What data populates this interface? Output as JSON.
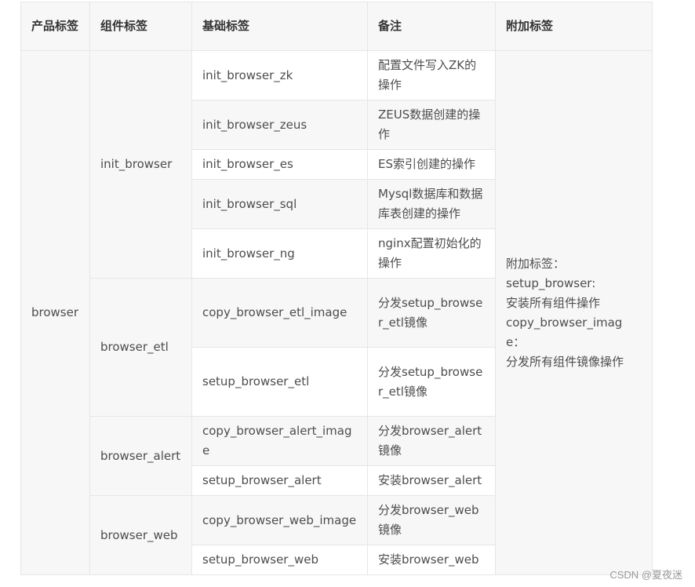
{
  "headers": {
    "product": "产品标签",
    "component": "组件标签",
    "base": "基础标签",
    "note": "备注",
    "extra": "附加标签"
  },
  "product": "browser",
  "components": {
    "c1": "init_browser",
    "c2": "browser_etl",
    "c3": "browser_alert",
    "c4": "browser_web"
  },
  "rows": [
    {
      "base": "init_browser_zk",
      "note": "配置文件写入ZK的操作"
    },
    {
      "base": "init_browser_zeus",
      "note": "ZEUS数据创建的操作"
    },
    {
      "base": "init_browser_es",
      "note": "ES索引创建的操作"
    },
    {
      "base": "init_browser_sql",
      "note": "Mysql数据库和数据库表创建的操作"
    },
    {
      "base": "init_browser_ng",
      "note": "nginx配置初始化的操作"
    },
    {
      "base": "copy_browser_etl_image",
      "note": "分发setup_browser_etl镜像"
    },
    {
      "base": "setup_browser_etl",
      "note": "分发setup_browser_etl镜像"
    },
    {
      "base": "copy_browser_alert_image",
      "note": "分发browser_alert镜像"
    },
    {
      "base": "setup_browser_alert",
      "note": "安装browser_alert"
    },
    {
      "base": "copy_browser_web_image",
      "note": "分发browser_web镜像"
    },
    {
      "base": "setup_browser_web",
      "note": "安装browser_web"
    }
  ],
  "extra_lines": [
    "附加标签：",
    "setup_browser:",
    "安装所有组件操作",
    "copy_browser_image：",
    "分发所有组件镜像操作"
  ],
  "watermark": "CSDN @夏夜迷"
}
